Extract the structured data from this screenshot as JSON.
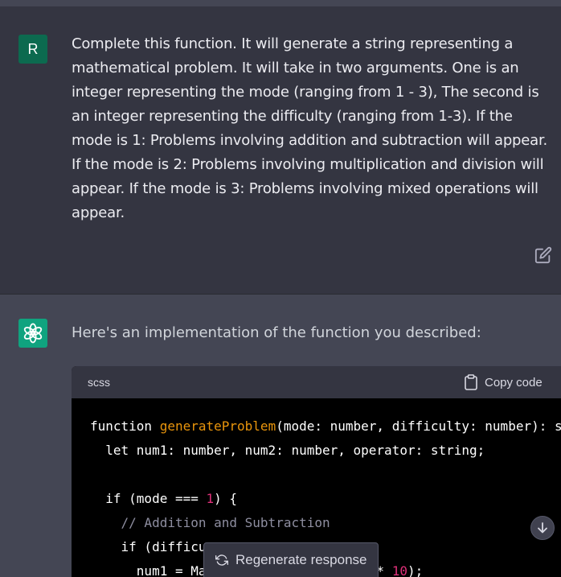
{
  "user_message": {
    "avatar_letter": "R",
    "text": "Complete this function. It will generate a string representing a mathematical problem. It will take in two arguments. One is an integer representing the mode (ranging from 1 - 3), The second is an integer representing the difficulty (ranging from 1-3). If the mode is 1: Problems involving addition and subtraction will appear. If the mode is 2: Problems involving multiplication and division will appear. If the mode is 3: Problems involving mixed operations will appear."
  },
  "assistant_message": {
    "intro": "Here's an implementation of the function you described:",
    "code_block": {
      "language": "scss",
      "copy_label": "Copy code",
      "line1": {
        "keyword": "function",
        "name": "generateProblem",
        "rest": "(mode: number, difficulty: number): s"
      },
      "line2": "let num1: number, num2: number, operator: string;",
      "line4": {
        "prefix": "if (mode === ",
        "number": "1",
        "suffix": ") {"
      },
      "line5": "// Addition and Subtraction",
      "line6": "if (difficu",
      "line7": {
        "prefix": "num1 = Ma",
        "gap": "                      ",
        "op": "* ",
        "number": "10",
        "suffix": ");"
      }
    }
  },
  "controls": {
    "regenerate_label": "Regenerate response"
  },
  "colors": {
    "background": "#343541",
    "assistant_background": "#444654",
    "user_avatar": "#0c6a4f",
    "gpt_avatar": "#10a37f",
    "code_background": "#000000",
    "code_function_name": "#e9950c",
    "code_number": "#df3079"
  },
  "icons": {
    "edit": "edit-icon",
    "copy": "clipboard-icon",
    "regenerate": "refresh-icon",
    "scroll_down": "arrow-down-icon",
    "assistant_logo": "openai-logo-icon"
  }
}
